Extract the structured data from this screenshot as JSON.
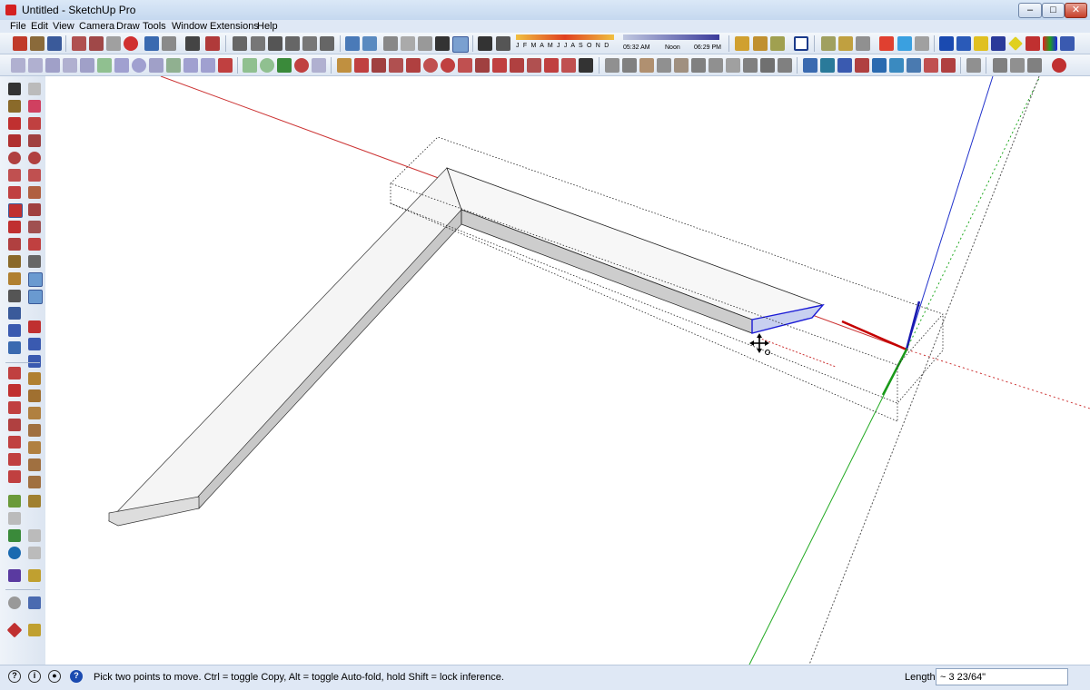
{
  "window": {
    "title": "Untitled - SketchUp Pro",
    "min_symbol": "–",
    "max_symbol": "□",
    "close_symbol": "✕"
  },
  "menu": [
    "File",
    "Edit",
    "View",
    "Camera",
    "Draw",
    "Tools",
    "Window",
    "Extensions",
    "Help"
  ],
  "shadow": {
    "months": "J F M A M J J A S O N D",
    "time_start": "05:32 AM",
    "time_mid": "Noon",
    "time_end": "06:29 PM"
  },
  "status": {
    "message": "Pick two points to move.  Ctrl = toggle Copy, Alt = toggle Auto-fold, hold Shift = lock inference.",
    "measure_label": "Length",
    "measure_value": "~ 3 23/64\""
  },
  "colors": {
    "red_axis": "#cc2222",
    "green_axis": "#22aa22",
    "blue_axis": "#2222cc",
    "selection": "#1a1ad6"
  }
}
